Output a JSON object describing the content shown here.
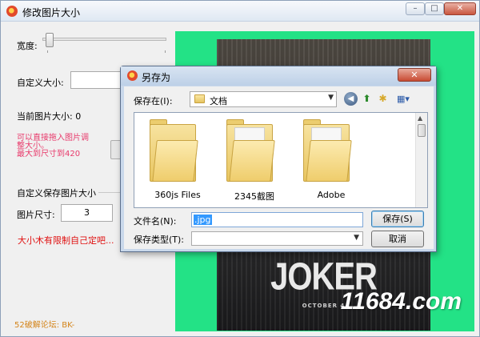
{
  "window": {
    "title": "修改图片大小",
    "controls": {
      "minimize": "–",
      "maximize": "□",
      "close": "✕"
    }
  },
  "left_panel": {
    "width_label": "宽度:",
    "custom_size_label": "自定义大小:",
    "custom_size_value": "",
    "current_size_label": "当前图片大小: 0",
    "hint_lines": [
      "可以直接拖入图片调",
      "整大小。",
      "最大到尺寸到420"
    ],
    "save_group_title": "自定义保存图片大小",
    "image_size_label": "图片尺寸:",
    "image_size_value": "3",
    "warning_text": "大小木有限制自己定吧...",
    "footer_text": "52破解论坛:  BK-"
  },
  "preview": {
    "poster_title": "JOKER",
    "poster_subtitle": "OCTOBER 4",
    "watermark": "11684.com",
    "bg_color": "#23e286"
  },
  "save_dialog": {
    "title": "另存为",
    "close": "✕",
    "save_in_label": "保存在(I):",
    "location": "文档",
    "toolbar": {
      "back_icon": "back-arrow-icon",
      "up_icon": "up-folder-icon",
      "new_folder_icon": "new-folder-icon",
      "views_icon": "views-menu-icon"
    },
    "files": [
      {
        "name": "360js Files",
        "icon": "folder-icon"
      },
      {
        "name": "2345截图",
        "icon": "folder-icon"
      },
      {
        "name": "Adobe",
        "icon": "folder-icon"
      }
    ],
    "filename_label": "文件名(N):",
    "filename_value": ".jpg",
    "filetype_label": "保存类型(T):",
    "filetype_value": "",
    "save_button": "保存(S)",
    "cancel_button": "取消"
  }
}
